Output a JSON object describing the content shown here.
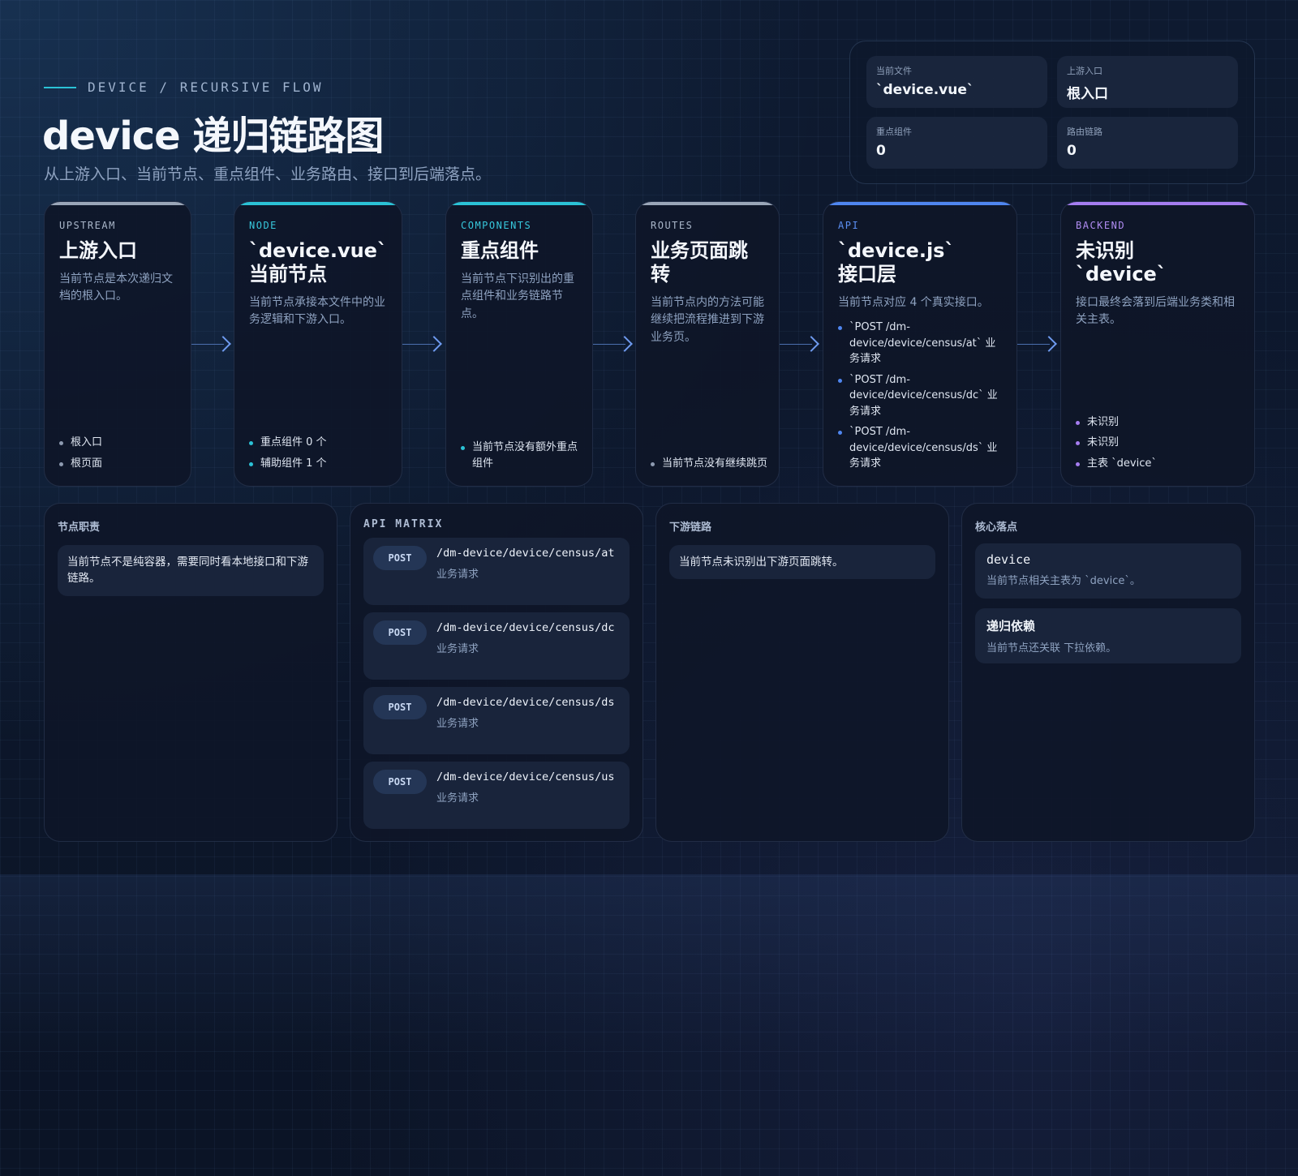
{
  "header": {
    "eyebrow": "DEVICE / RECURSIVE FLOW",
    "title": "device 递归链路图",
    "subtitle": "从上游入口、当前节点、重点组件、业务路由、接口到后端落点。"
  },
  "stats": [
    {
      "label": "当前文件",
      "value": "`device.vue`"
    },
    {
      "label": "上游入口",
      "value": "根入口"
    },
    {
      "label": "重点组件",
      "value": "0"
    },
    {
      "label": "路由链路",
      "value": "0"
    }
  ],
  "flow": {
    "upstream": {
      "tag": "UPSTREAM",
      "title": "上游入口",
      "desc": "当前节点是本次递归文档的根入口。",
      "items": [
        "根入口",
        "根页面"
      ]
    },
    "node": {
      "tag": "NODE",
      "title_line1": "`device.vue`",
      "title_line2": "当前节点",
      "desc": "当前节点承接本文件中的业务逻辑和下游入口。",
      "items": [
        "重点组件 0 个",
        "辅助组件 1 个"
      ]
    },
    "components": {
      "tag": "COMPONENTS",
      "title": "重点组件",
      "desc": "当前节点下识别出的重点组件和业务链路节点。",
      "items": [
        "当前节点没有额外重点组件"
      ]
    },
    "routes": {
      "tag": "ROUTES",
      "title": "业务页面跳转",
      "desc": "当前节点内的方法可能继续把流程推进到下游业务页。",
      "items": [
        "当前节点没有继续跳页"
      ]
    },
    "api": {
      "tag": "API",
      "title_line1": "`device.js`",
      "title_line2": "接口层",
      "desc": "当前节点对应 4 个真实接口。",
      "items": [
        "`POST /dm-device/device/census/at` 业务请求",
        "`POST /dm-device/device/census/dc` 业务请求",
        "`POST /dm-device/device/census/ds` 业务请求"
      ]
    },
    "backend": {
      "tag": "BACKEND",
      "title_line1": "未识别",
      "title_line2": "`device`",
      "desc": "接口最终会落到后端业务类和相关主表。",
      "items": [
        "未识别",
        "未识别",
        "主表 `device`"
      ]
    }
  },
  "panels": {
    "duty": {
      "heading": "节点职责",
      "note": "当前节点不是纯容器，需要同时看本地接口和下游链路。"
    },
    "api_matrix": {
      "heading": "API MATRIX",
      "items": [
        {
          "method": "POST",
          "path": "/dm-device/device/census/at",
          "desc": "业务请求"
        },
        {
          "method": "POST",
          "path": "/dm-device/device/census/dc",
          "desc": "业务请求"
        },
        {
          "method": "POST",
          "path": "/dm-device/device/census/ds",
          "desc": "业务请求"
        },
        {
          "method": "POST",
          "path": "/dm-device/device/census/us",
          "desc": "业务请求"
        }
      ]
    },
    "downstream": {
      "heading": "下游链路",
      "note": "当前节点未识别出下游页面跳转。"
    },
    "core": {
      "heading": "核心落点",
      "items": [
        {
          "title": "device",
          "desc": "当前节点相关主表为 `device`。"
        },
        {
          "title": "递归依赖",
          "desc": "当前节点还关联 下拉依赖。"
        }
      ]
    }
  },
  "colors": {
    "upstream": "#9aa6b8",
    "node": "#2bc2d6",
    "components": "#2bc2d6",
    "routes": "#9aa6b8",
    "api": "#4f86f0",
    "backend": "#a57df0"
  }
}
